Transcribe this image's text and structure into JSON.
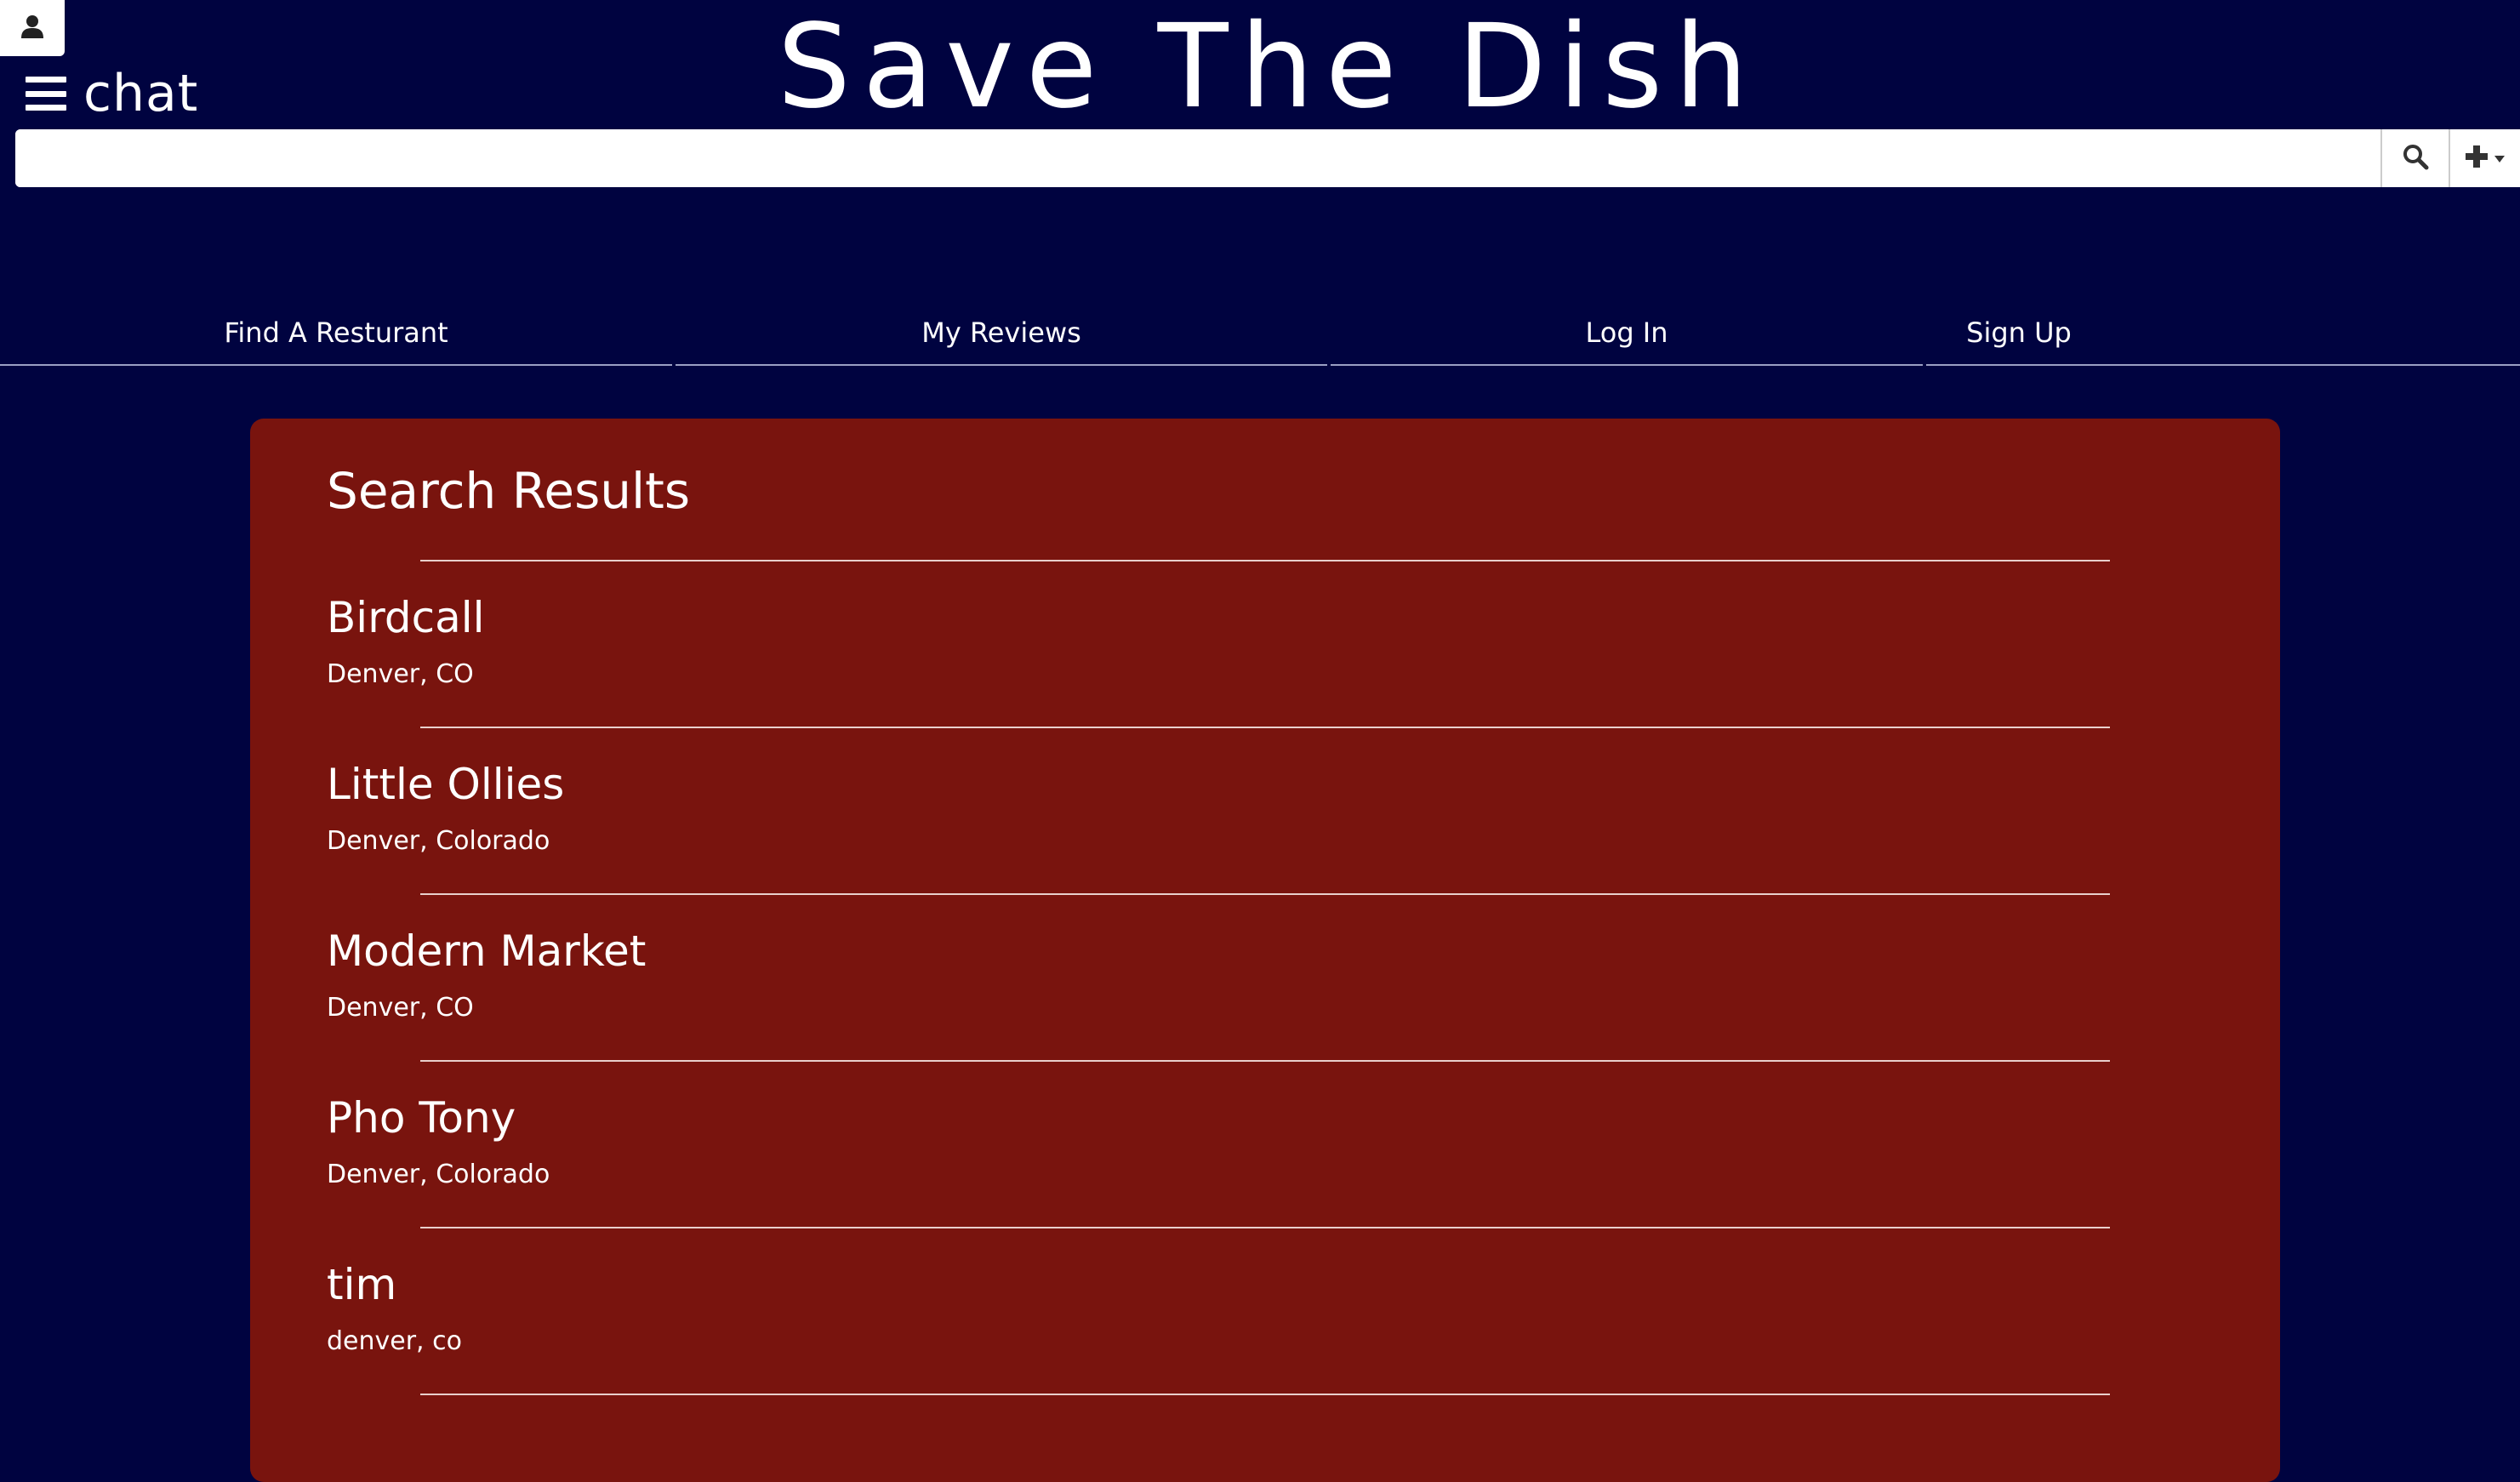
{
  "app": {
    "title": "Save The Dish",
    "chat_label": "chat"
  },
  "search": {
    "value": "",
    "placeholder": ""
  },
  "nav": {
    "items": [
      {
        "label": "Find A Resturant"
      },
      {
        "label": "My Reviews"
      },
      {
        "label": "Log In"
      },
      {
        "label": "Sign Up"
      }
    ]
  },
  "results": {
    "title": "Search Results",
    "items": [
      {
        "name": "Birdcall",
        "location": "Denver, CO"
      },
      {
        "name": "Little Ollies",
        "location": "Denver, Colorado"
      },
      {
        "name": "Modern Market",
        "location": "Denver, CO"
      },
      {
        "name": "Pho Tony",
        "location": "Denver, Colorado"
      },
      {
        "name": "tim",
        "location": "denver, co"
      }
    ]
  },
  "colors": {
    "background": "#000340",
    "panel": "#79140e",
    "text": "#ffffff"
  },
  "icons": {
    "user": "user-icon",
    "menu": "hamburger-menu-icon",
    "search": "search-icon",
    "add": "plus-icon",
    "dropdown": "caret-down-icon"
  }
}
